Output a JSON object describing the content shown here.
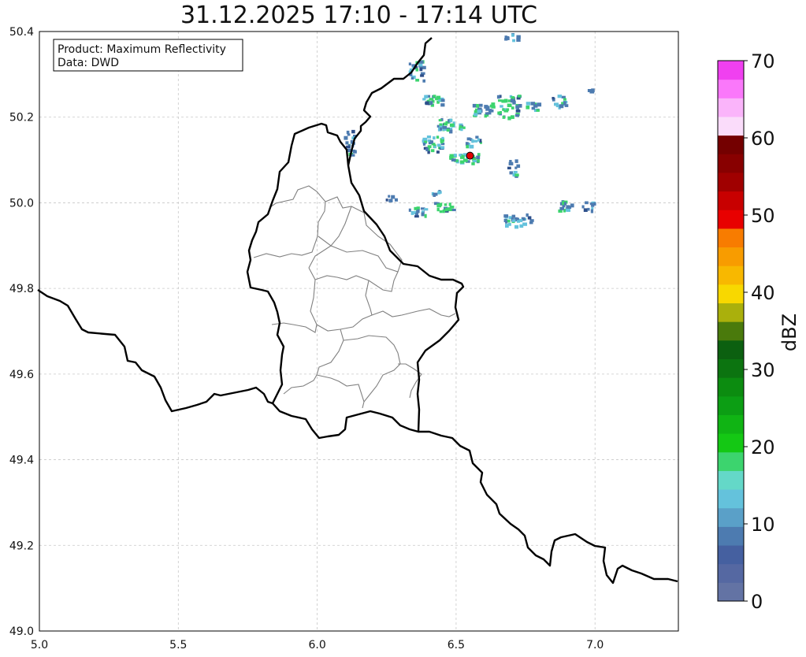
{
  "title": "31.12.2025 17:10 - 17:14 UTC",
  "info_box": {
    "line1": "Product: Maximum Reflectivity",
    "line2": "Data: DWD"
  },
  "map": {
    "lon_range": [
      5.0,
      7.3
    ],
    "lat_range": [
      49.0,
      50.4
    ],
    "x_ticks": [
      "5.0",
      "5.5",
      "6.0",
      "6.5",
      "7.0"
    ],
    "y_ticks": [
      "49.0",
      "49.2",
      "49.4",
      "49.6",
      "49.8",
      "50.0",
      "50.2",
      "50.4"
    ],
    "grid": true,
    "marker": {
      "lon": 6.55,
      "lat": 50.11,
      "color": "#e00000"
    }
  },
  "colorbar": {
    "label": "dBZ",
    "range": [
      0,
      70
    ],
    "tick_labels": [
      "0",
      "10",
      "20",
      "30",
      "40",
      "50",
      "60",
      "70"
    ],
    "colors": [
      "#6373a4",
      "#5568a2",
      "#4560a0",
      "#4d7bb0",
      "#5aa0c8",
      "#64c2dc",
      "#64d8c8",
      "#3cd46e",
      "#14c814",
      "#10b414",
      "#0c9e14",
      "#0c8c10",
      "#0c7410",
      "#0c6010",
      "#4a7a0c",
      "#aab00c",
      "#f8d800",
      "#f8b800",
      "#f89c00",
      "#f87c00",
      "#e80000",
      "#c80000",
      "#a00000",
      "#880000",
      "#740000",
      "#fadcfa",
      "#fab4fa",
      "#fa78fa",
      "#f040f0"
    ]
  },
  "echo_colors": {
    "weak": "#4d7bb0",
    "medium": "#64c2dc",
    "strong": "#3cd46e",
    "dark": "#2e4f8a"
  }
}
